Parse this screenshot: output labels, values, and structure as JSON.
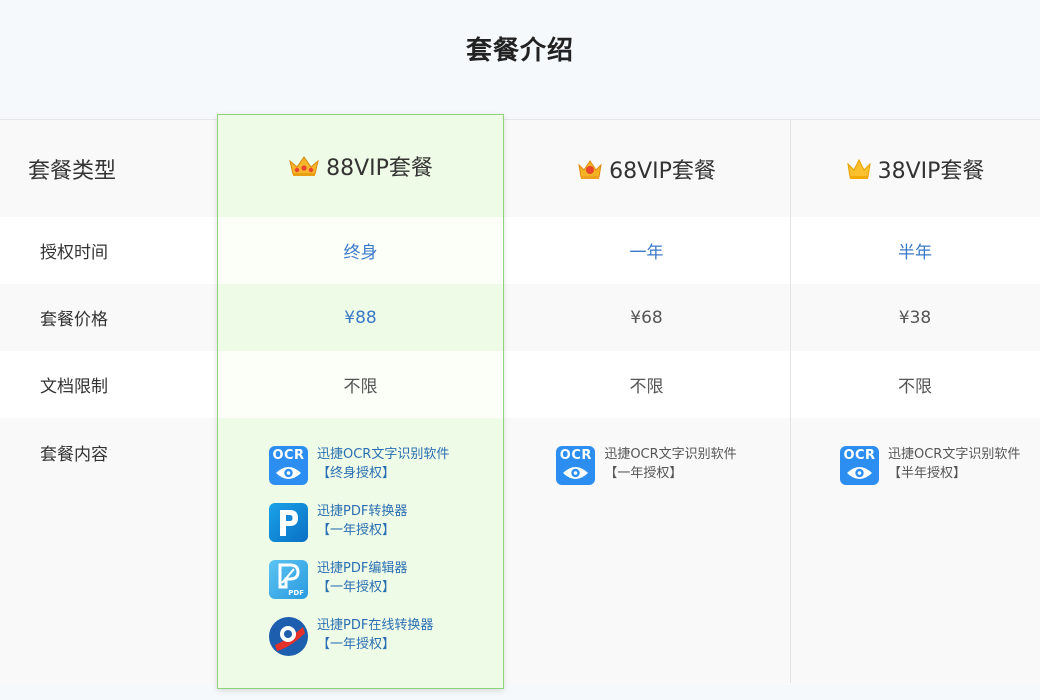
{
  "page": {
    "title": "套餐介绍"
  },
  "table": {
    "row_header_label": "套餐类型",
    "plans": [
      {
        "name": "88VIP套餐",
        "crown": "crown-gold-ornate-icon"
      },
      {
        "name": "68VIP套餐",
        "crown": "crown-red-icon"
      },
      {
        "name": "38VIP套餐",
        "crown": "crown-yellow-icon"
      }
    ],
    "rows": [
      {
        "label": "授权时间",
        "values": [
          "终身",
          "一年",
          "半年"
        ]
      },
      {
        "label": "套餐价格",
        "values": [
          "¥88",
          "¥68",
          "¥38"
        ]
      },
      {
        "label": "文档限制",
        "values": [
          "不限",
          "不限",
          "不限"
        ]
      }
    ],
    "content_row": {
      "label": "套餐内容",
      "plan_88": [
        {
          "name": "迅捷OCR文字识别软件",
          "term": "【终身授权】",
          "icon": "ocr-icon"
        },
        {
          "name": "迅捷PDF转换器",
          "term": "【一年授权】",
          "icon": "pdf-converter-icon"
        },
        {
          "name": "迅捷PDF编辑器",
          "term": "【一年授权】",
          "icon": "pdf-editor-icon"
        },
        {
          "name": "迅捷PDF在线转换器",
          "term": "【一年授权】",
          "icon": "pdf-online-converter-icon"
        }
      ],
      "plan_68": [
        {
          "name": "迅捷OCR文字识别软件",
          "term": "【一年授权】",
          "icon": "ocr-icon"
        }
      ],
      "plan_38": [
        {
          "name": "迅捷OCR文字识别软件",
          "term": "【半年授权】",
          "icon": "ocr-icon"
        }
      ],
      "ocr_icon_label": "OCR",
      "pdf_icon_label": "PDF"
    }
  },
  "colors": {
    "accent_blue": "#3a79c8",
    "highlight_border": "#8fd27a",
    "highlight_bg": "#eefbe6",
    "ocr_blue": "#2b8ef0"
  }
}
